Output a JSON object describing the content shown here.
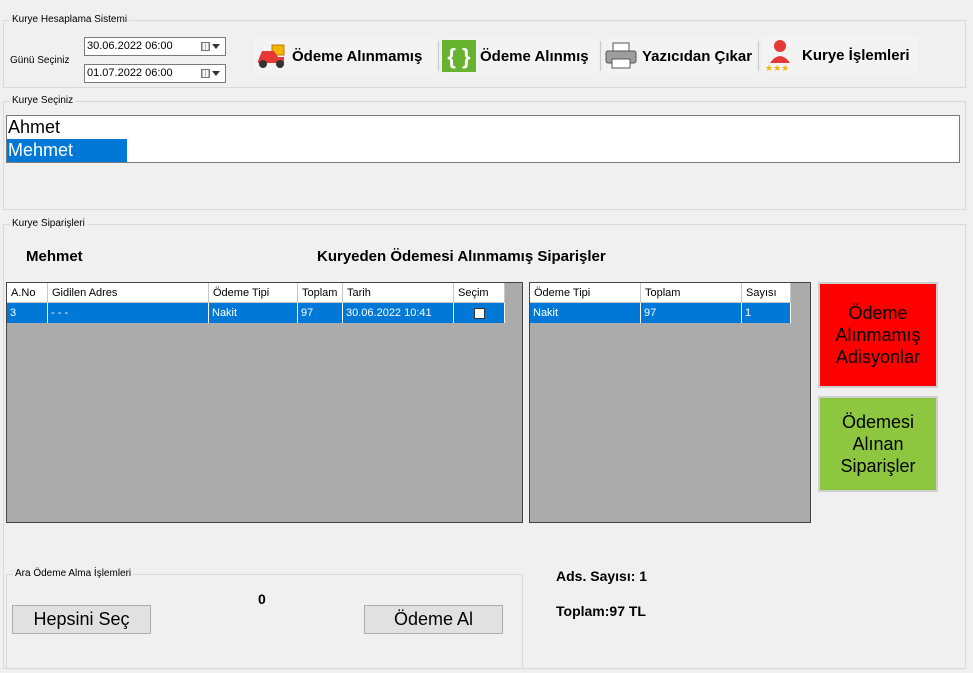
{
  "top_group": {
    "legend": "Kurye Hesaplama Sistemi",
    "date_label": "Günü Seçiniz",
    "date_from": "30.06.2022 06:00",
    "date_to": "01.07.2022 06:00"
  },
  "toolbar": {
    "unpaid_label": "Ödeme Alınmamış",
    "paid_label": "Ödeme Alınmış",
    "print_label": "Yazıcıdan Çıkar",
    "courier_label": "Kurye İşlemleri"
  },
  "courier_group": {
    "legend": "Kurye Seçiniz",
    "items": [
      "Ahmet",
      "Mehmet"
    ],
    "selected": "Mehmet"
  },
  "orders_group": {
    "legend": "Kurye Siparişleri",
    "courier_name": "Mehmet",
    "title": "Kuryeden Ödemesi Alınmamış Siparişler",
    "orders_table": {
      "headers": [
        "A.No",
        "Gidilen Adres",
        "Ödeme Tipi",
        "Toplam",
        "Tarih",
        "Seçim"
      ],
      "rows": [
        [
          "3",
          "- - -",
          "Nakit",
          "97",
          "30.06.2022 10:41",
          ""
        ]
      ]
    },
    "summary_table": {
      "headers": [
        "Ödeme Tipi",
        "Toplam",
        "Sayısı"
      ],
      "rows": [
        [
          "Nakit",
          "97",
          "1"
        ]
      ]
    },
    "unpaid_button": "Ödeme Alınmamış Adisyonlar",
    "paid_button": "Ödemesi Alınan Siparişler"
  },
  "payment_group": {
    "legend": "Ara Ödeme Alma İşlemleri",
    "count": "0",
    "select_all": "Hepsini Seç",
    "take_payment": "Ödeme Al"
  },
  "totals": {
    "ads_count": "Ads. Sayısı: 1",
    "total": "Toplam:97 TL"
  },
  "colors": {
    "selection": "#0078d7",
    "unpaid_button": "#ff0000",
    "paid_button": "#8dc63f"
  }
}
